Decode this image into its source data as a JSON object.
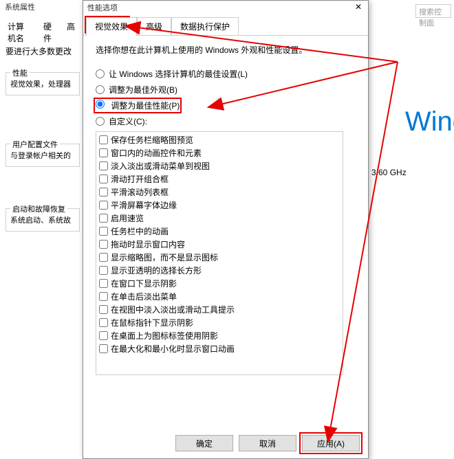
{
  "bg": {
    "title": "系统属性",
    "tabs": [
      "计算机名",
      "硬件",
      "高"
    ],
    "line1": "要进行大多数更改",
    "group1_title": "性能",
    "group1_text": "视觉效果，处理器",
    "group2_title": "用户配置文件",
    "group2_text": "与登录帐户相关的",
    "group3_title": "启动和故障恢复",
    "group3_text": "系统启动、系统故",
    "search_placeholder": "搜索控制面",
    "wind": "Wind",
    "ghz": "3.60 GHz"
  },
  "dialog": {
    "title": "性能选项",
    "tabs": [
      "视觉效果",
      "高级",
      "数据执行保护"
    ],
    "desc": "选择你想在此计算机上使用的 Windows 外观和性能设置。",
    "radios": [
      "让 Windows 选择计算机的最佳设置(L)",
      "调整为最佳外观(B)",
      "调整为最佳性能(P)",
      "自定义(C):"
    ],
    "checks": [
      "保存任务栏缩略图预览",
      "窗口内的动画控件和元素",
      "淡入淡出或滑动菜单到视图",
      "滑动打开组合框",
      "平滑滚动列表框",
      "平滑屏幕字体边缘",
      "启用速览",
      "任务栏中的动画",
      "拖动时显示窗口内容",
      "显示缩略图，而不是显示图标",
      "显示亚透明的选择长方形",
      "在窗口下显示阴影",
      "在单击后淡出菜单",
      "在视图中淡入淡出或滑动工具提示",
      "在鼠标指针下显示阴影",
      "在桌面上为图标标签使用阴影",
      "在最大化和最小化时显示窗口动画"
    ],
    "buttons": {
      "ok": "确定",
      "cancel": "取消",
      "apply": "应用(A)"
    }
  }
}
